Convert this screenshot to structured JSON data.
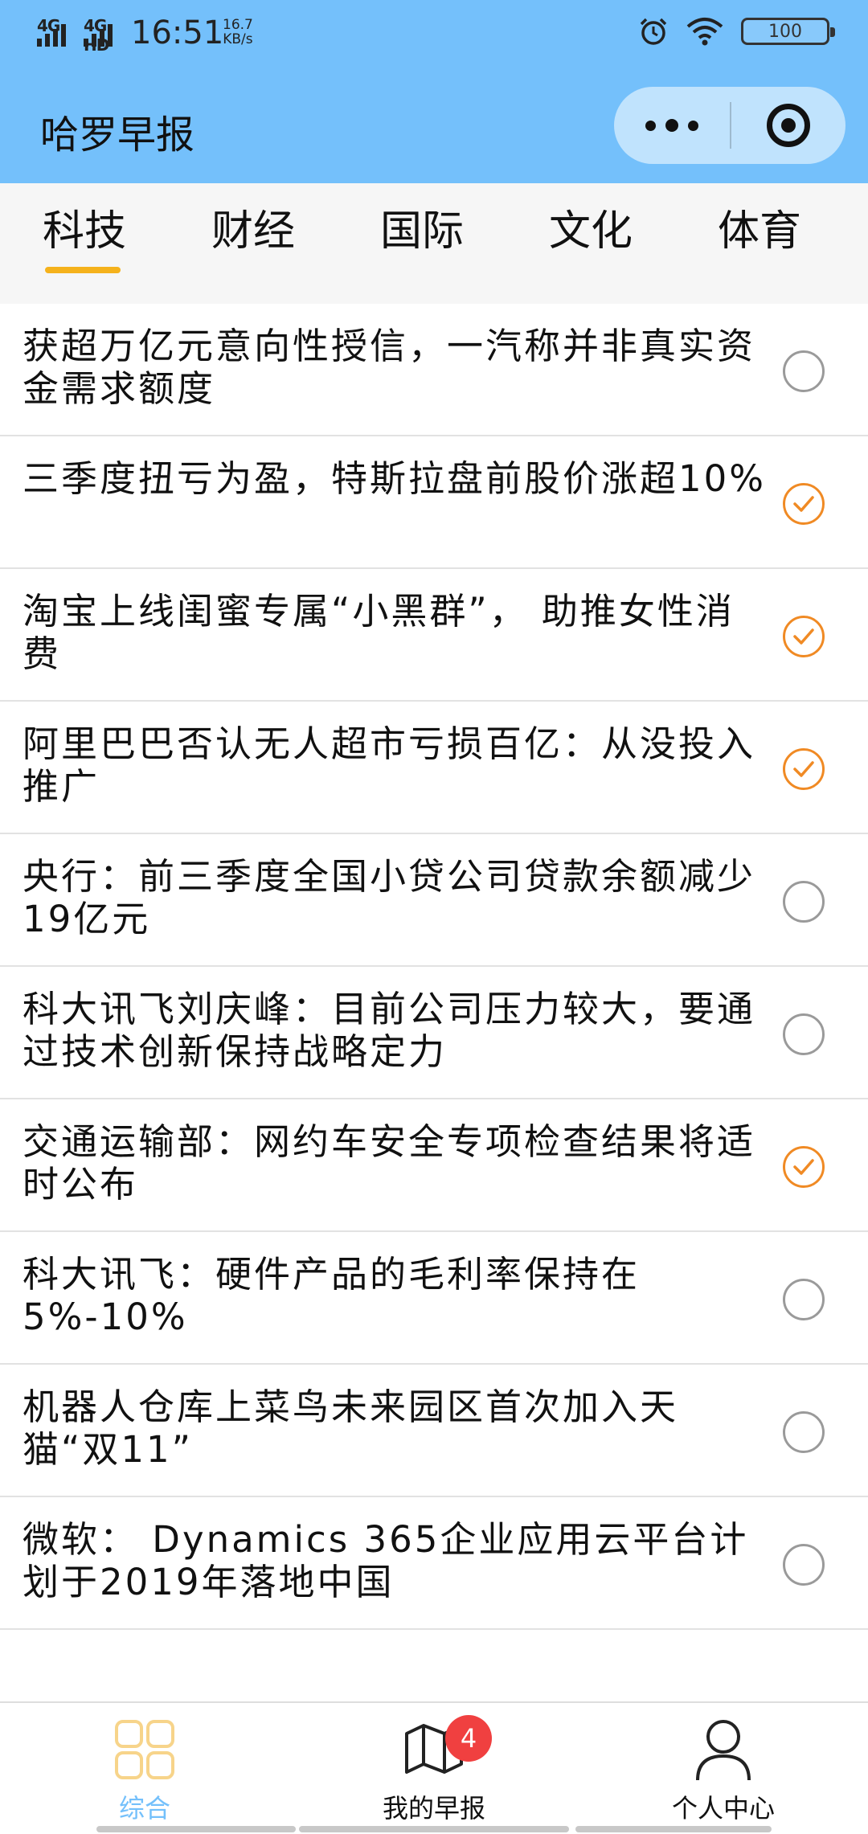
{
  "status_bar": {
    "net1": "4G",
    "net2": "4G HD",
    "time": "16:51",
    "speed_value": "16.7",
    "speed_unit": "KB/s",
    "battery": "100",
    "icons": [
      "alarm-icon",
      "wifi-icon",
      "battery-icon"
    ]
  },
  "header": {
    "title": "哈罗早报",
    "capsule_icons": [
      "more-icon",
      "close-target-icon"
    ]
  },
  "tabs": [
    {
      "label": "科技",
      "active": true
    },
    {
      "label": "财经",
      "active": false
    },
    {
      "label": "国际",
      "active": false
    },
    {
      "label": "文化",
      "active": false
    },
    {
      "label": "体育",
      "active": false
    }
  ],
  "news": [
    {
      "title": "获超万亿元意向性授信，一汽称并非真实资金需求额度",
      "checked": false
    },
    {
      "title": "三季度扭亏为盈，特斯拉盘前股价涨超10%",
      "checked": true
    },
    {
      "title": "淘宝上线闺蜜专属“小黑群”， 助推女性消费",
      "checked": true
    },
    {
      "title": "阿里巴巴否认无人超市亏损百亿：从没投入推广",
      "checked": true
    },
    {
      "title": "央行：前三季度全国小贷公司贷款余额减少19亿元",
      "checked": false
    },
    {
      "title": "科大讯飞刘庆峰：目前公司压力较大，要通过技术创新保持战略定力",
      "checked": false
    },
    {
      "title": "交通运输部：网约车安全专项检查结果将适时公布",
      "checked": true
    },
    {
      "title": "科大讯飞：硬件产品的毛利率保持在5%-10%",
      "checked": false
    },
    {
      "title": "机器人仓库上菜鸟未来园区首次加入天猫“双11”",
      "checked": false
    },
    {
      "title": "微软： Dynamics 365企业应用云平台计划于2019年落地中国",
      "checked": false
    }
  ],
  "tabbar": {
    "items": [
      {
        "label": "综合",
        "icon": "grid-icon",
        "active": true
      },
      {
        "label": "我的早报",
        "icon": "map-icon",
        "active": false
      },
      {
        "label": "个人中心",
        "icon": "person-icon",
        "active": false
      }
    ],
    "badge": "4"
  },
  "colors": {
    "header_bg": "#74c0fb",
    "accent_underline": "#f5b21c",
    "check_on": "#f08a24",
    "badge": "#f04040"
  }
}
